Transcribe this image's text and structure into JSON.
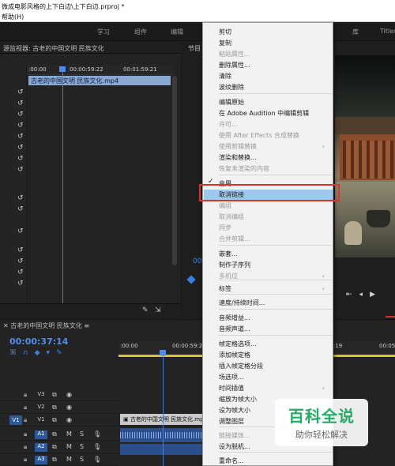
{
  "window": {
    "title": "微成电影风格的上下白边\\上下白边.prproj *",
    "menu": "帮助(H)"
  },
  "workspaces": {
    "items": [
      "学习",
      "组件",
      "编辑",
      "库",
      "Titles"
    ]
  },
  "source_panel": {
    "title": "源监视器: 古老的中国文明 民族文化",
    "ruler": [
      ":00:00",
      "00:00:59:22",
      "00:01:59:21"
    ],
    "clip_name": "古老的中国文明 民族文化.mp4"
  },
  "program_panel": {
    "title": "节目",
    "timecode": "00"
  },
  "timeline": {
    "sequence_tab": "古老的中国文明 民族文化",
    "timecode": "00:00:37:14",
    "ruler": [
      ":00:00",
      "00:00:59:22",
      ":19",
      "00:05"
    ],
    "tracks": [
      {
        "label": "V3"
      },
      {
        "label": "V2"
      },
      {
        "label": "V1",
        "selected": true
      },
      {
        "label": "A1",
        "selected": true
      },
      {
        "label": "A2",
        "selected": true
      },
      {
        "label": "A3",
        "selected": true
      }
    ],
    "track_btn_m": "M",
    "track_btn_s": "S",
    "clip_video": "古老的中国文明 民族文化.mp",
    "v1_source": "V1"
  },
  "context_menu": {
    "items": [
      {
        "label": "剪切",
        "enabled": true
      },
      {
        "label": "复制",
        "enabled": true
      },
      {
        "label": "粘贴属性...",
        "enabled": false
      },
      {
        "label": "删除属性...",
        "enabled": true
      },
      {
        "label": "清除",
        "enabled": true
      },
      {
        "label": "波纹删除",
        "enabled": true
      },
      {
        "label": "编辑原始",
        "enabled": true
      },
      {
        "label": "在 Adobe Audition 中编辑剪辑",
        "enabled": true
      },
      {
        "label": "许可...",
        "enabled": false
      },
      {
        "label": "使用 After Effects 合成替换",
        "enabled": false
      },
      {
        "label": "使用剪辑替换",
        "enabled": false,
        "submenu": true
      },
      {
        "label": "渲染和替换...",
        "enabled": true
      },
      {
        "label": "恢复未渲染的内容",
        "enabled": false
      },
      {
        "label": "启用",
        "enabled": true,
        "checked": true
      },
      {
        "label": "取消链接",
        "enabled": true,
        "highlighted": true
      },
      {
        "label": "编组",
        "enabled": false
      },
      {
        "label": "取消编组",
        "enabled": false
      },
      {
        "label": "同步",
        "enabled": false
      },
      {
        "label": "合并剪辑...",
        "enabled": false
      },
      {
        "label": "嵌套...",
        "enabled": true
      },
      {
        "label": "制作子序列",
        "enabled": true
      },
      {
        "label": "多机位",
        "enabled": false,
        "submenu": true
      },
      {
        "label": "标签",
        "enabled": true,
        "submenu": true
      },
      {
        "label": "速度/持续时间...",
        "enabled": true
      },
      {
        "label": "音频增益...",
        "enabled": true
      },
      {
        "label": "音频声道...",
        "enabled": true
      },
      {
        "label": "帧定格选项...",
        "enabled": true
      },
      {
        "label": "添加帧定格",
        "enabled": true
      },
      {
        "label": "插入帧定格分段",
        "enabled": true
      },
      {
        "label": "场选项...",
        "enabled": true
      },
      {
        "label": "时间插值",
        "enabled": true,
        "submenu": true
      },
      {
        "label": "缩放为帧大小",
        "enabled": true
      },
      {
        "label": "设为帧大小",
        "enabled": true
      },
      {
        "label": "调整图层",
        "enabled": true
      },
      {
        "label": "链接媒体...",
        "enabled": false
      },
      {
        "label": "设为脱机...",
        "enabled": true
      },
      {
        "label": "重命名...",
        "enabled": true
      }
    ]
  },
  "watermark": {
    "title": "百科全说",
    "subtitle": "助你轻松解决"
  },
  "colors": {
    "accent": "#3f82e0",
    "highlight": "#9ec8f0",
    "annotation": "#e0312d",
    "watermark": "#1fae63"
  }
}
